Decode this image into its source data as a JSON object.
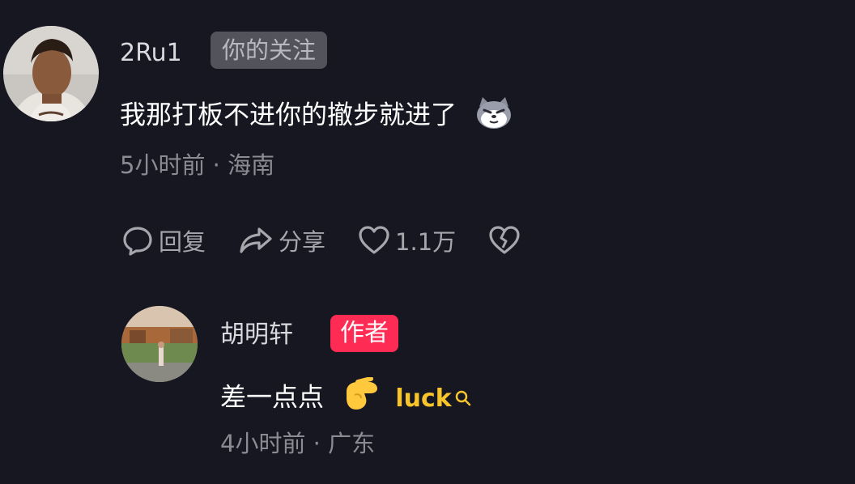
{
  "comments": [
    {
      "username": "2Ru1",
      "badge": "你的关注",
      "text": "我那打板不进你的撤步就进了",
      "emoji": "doge-emoji",
      "meta": "5小时前 · 海南",
      "actions": {
        "reply_label": "回复",
        "share_label": "分享",
        "like_count": "1.1万"
      }
    }
  ],
  "reply": {
    "username": "胡明轩",
    "badge": "作者",
    "text": "差一点点",
    "emoji": "pinching-hand-emoji",
    "luck_link": "luck",
    "meta": "4小时前 · 广东"
  },
  "colors": {
    "background": "#161721",
    "author_badge": "#fe2c55",
    "luck": "#f7c52b"
  }
}
